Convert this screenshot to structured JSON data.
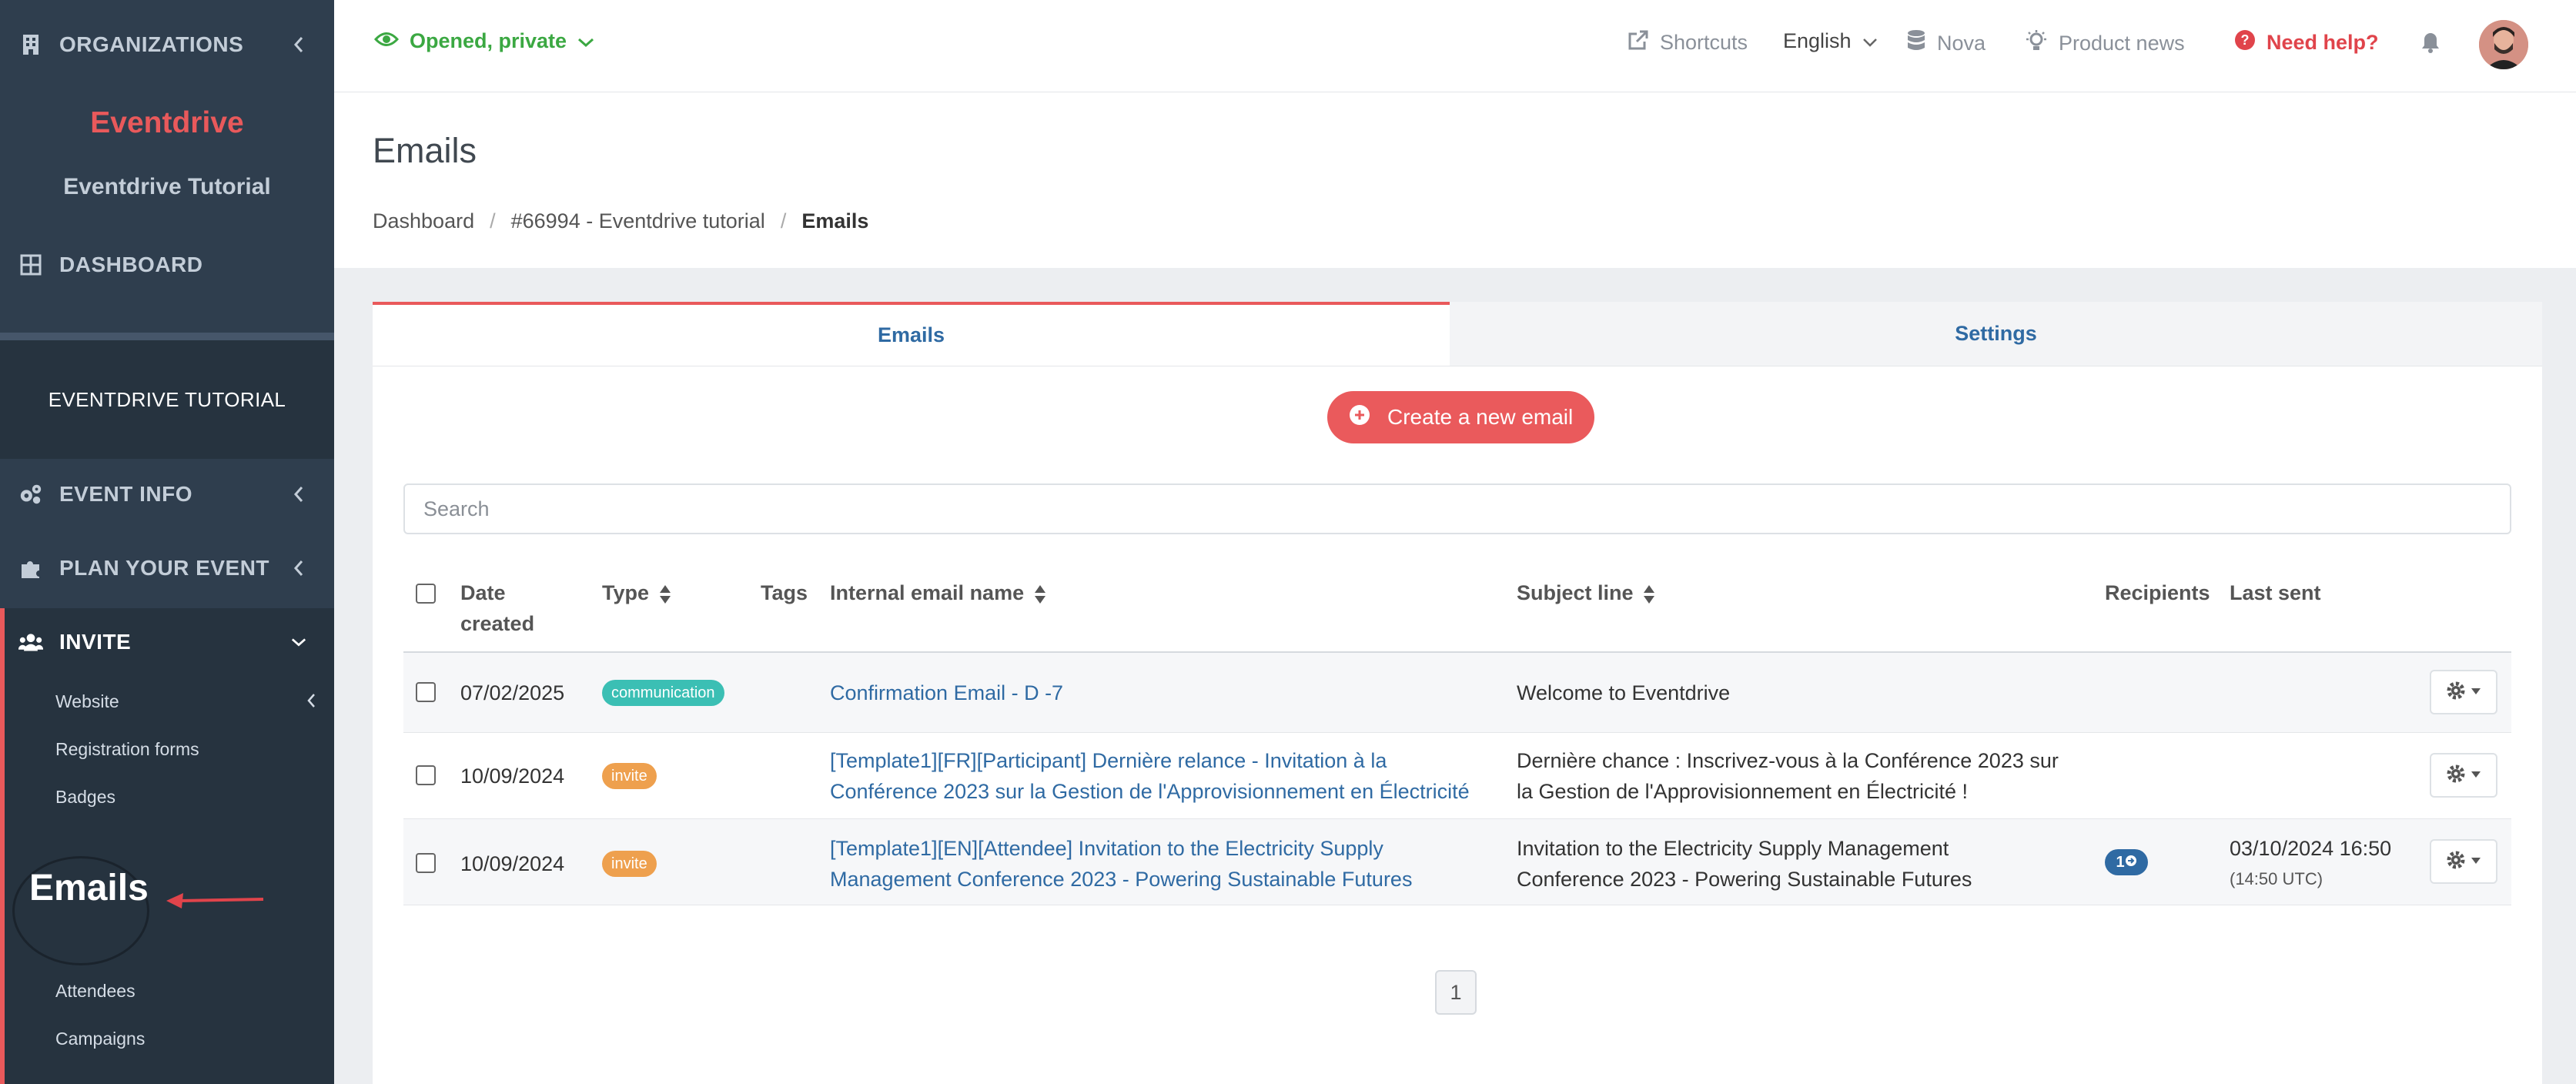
{
  "sidebar": {
    "organizations_label": "ORGANIZATIONS",
    "org_name": "Eventdrive",
    "org_subtitle": "Eventdrive Tutorial",
    "dashboard_label": "DASHBOARD",
    "event_title": "EVENTDRIVE TUTORIAL",
    "event_info_label": "EVENT INFO",
    "plan_label": "PLAN YOUR EVENT",
    "invite_label": "INVITE",
    "invite_items": [
      "Website",
      "Registration forms",
      "Badges",
      "Attendees",
      "Campaigns"
    ],
    "emails_highlight": "Emails"
  },
  "topbar": {
    "status": "Opened, private",
    "shortcuts": "Shortcuts",
    "language": "English",
    "workspace": "Nova",
    "product_news": "Product news",
    "help": "Need help?"
  },
  "page": {
    "title": "Emails",
    "breadcrumb": [
      "Dashboard",
      "#66994 - Eventdrive tutorial",
      "Emails"
    ]
  },
  "tabs": {
    "emails": "Emails",
    "settings": "Settings"
  },
  "create_button": "Create a new email",
  "search_placeholder": "Search",
  "table": {
    "headers": {
      "date_created": [
        "Date",
        "created"
      ],
      "type": "Type",
      "tags": "Tags",
      "internal_name": "Internal email name",
      "subject": "Subject line",
      "recipients": "Recipients",
      "last_sent": "Last sent"
    },
    "rows": [
      {
        "date": "07/02/2025",
        "type": "communication",
        "name": [
          "Confirmation Email - D -7"
        ],
        "subject": [
          "Welcome to Eventdrive"
        ],
        "recipients": "",
        "last_sent": [
          "",
          ""
        ]
      },
      {
        "date": "10/09/2024",
        "type": "invite",
        "name": [
          "[Template1][FR][Participant] Dernière relance - Invitation à la",
          "Conférence 2023 sur la Gestion de l'Approvisionnement en Électricité"
        ],
        "subject": [
          "Dernière chance : Inscrivez-vous à la Conférence 2023 sur",
          "la Gestion de l'Approvisionnement en Électricité !"
        ],
        "recipients": "",
        "last_sent": [
          "",
          ""
        ]
      },
      {
        "date": "10/09/2024",
        "type": "invite",
        "name": [
          "[Template1][EN][Attendee] Invitation to the Electricity Supply",
          "Management Conference 2023 - Powering Sustainable Futures"
        ],
        "subject": [
          "Invitation to the Electricity Supply Management",
          "Conference 2023 - Powering Sustainable Futures"
        ],
        "recipients": "1",
        "last_sent": [
          "03/10/2024 16:50",
          "(14:50 UTC)"
        ]
      }
    ]
  },
  "pagination": {
    "current": "1"
  },
  "colors": {
    "accent": "#e9595b",
    "link": "#2f6aa3",
    "sidebar": "#2f3e4e",
    "status_green": "#3ba842"
  }
}
